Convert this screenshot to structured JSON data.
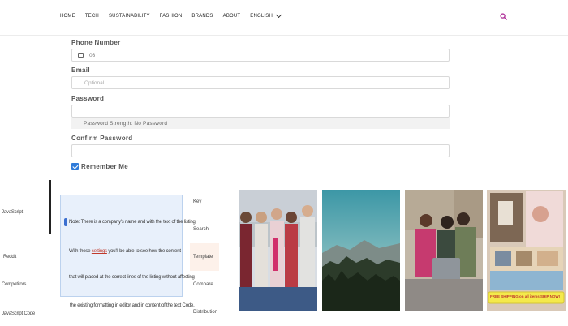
{
  "nav": {
    "items": [
      "HOME",
      "TECH",
      "SUSTAINABILITY",
      "FASHION",
      "BRANDS",
      "ABOUT"
    ],
    "language": "ENGLISH"
  },
  "form": {
    "phone_label": "Phone Number",
    "phone_value": "03",
    "email_label": "Email",
    "email_placeholder": "Optional",
    "password_label": "Password",
    "password_strength": "Password Strength: No Password",
    "confirm_label": "Confirm Password",
    "remember_label": "Remember Me"
  },
  "colors": {
    "accent": "#b0339a",
    "checkbox": "#2f7bd9"
  },
  "icons": {
    "search": "search-icon",
    "phone": "phone-icon",
    "chevron": "chevron-down-icon"
  },
  "sidebar": {
    "labels": [
      "JavaScript",
      "Reddit",
      "Competitors",
      "JavaScript Code"
    ]
  },
  "pane": {
    "lines": [
      "Note: There is a company's name and with the text of the listing.",
      "With these",
      "settings",
      "you'll be able to see how the content",
      "that will placed at the correct lines of the listing without affecting",
      "the existing formatting in editor and in content of the text Code."
    ]
  },
  "tabs": [
    "Key",
    "Search",
    "Template",
    "Compare",
    "Distribution"
  ],
  "banner": {
    "text": "FREE SHIPPING on all items SHIP NOW!"
  }
}
